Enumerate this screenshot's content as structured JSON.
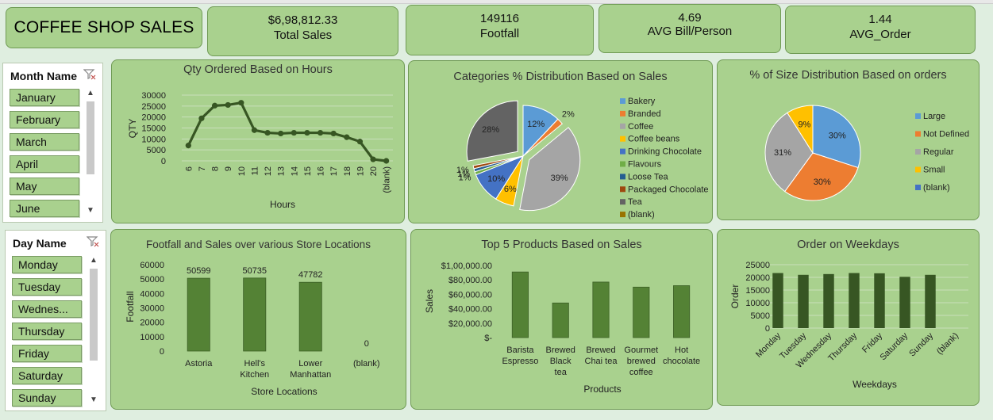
{
  "header": {
    "title": "COFFEE SHOP SALES",
    "kpis": [
      {
        "value": "$6,98,812.33",
        "label": "Total Sales"
      },
      {
        "value": "149116",
        "label": "Footfall"
      },
      {
        "value": "4.69",
        "label": "AVG Bill/Person"
      },
      {
        "value": "1.44",
        "label": "AVG_Order"
      }
    ]
  },
  "slicers": {
    "month": {
      "title": "Month Name",
      "items": [
        "January",
        "February",
        "March",
        "April",
        "May",
        "June"
      ]
    },
    "day": {
      "title": "Day Name",
      "items": [
        "Monday",
        "Tuesday",
        "Wednes...",
        "Thursday",
        "Friday",
        "Saturday",
        "Sunday"
      ]
    }
  },
  "colors": {
    "card_bg": "#a9d18e",
    "series_dark": "#375623",
    "bar_green": "#548235",
    "slicer_btn": "#a9d18e"
  },
  "chart_data": [
    {
      "type": "line",
      "title": "Qty Ordered Based on Hours",
      "xlabel": "Hours",
      "ylabel": "QTY",
      "categories": [
        "6",
        "7",
        "8",
        "9",
        "10",
        "11",
        "12",
        "13",
        "14",
        "15",
        "16",
        "17",
        "18",
        "19",
        "20",
        "(blank)"
      ],
      "values": [
        7000,
        19400,
        25200,
        25500,
        26500,
        14000,
        12800,
        12500,
        12800,
        12800,
        12800,
        12500,
        10800,
        8800,
        700,
        0
      ],
      "ylim": [
        0,
        30000
      ],
      "yticks": [
        "0",
        "5000",
        "10000",
        "15000",
        "20000",
        "25000",
        "30000"
      ],
      "grid": true
    },
    {
      "type": "pie",
      "title": "Categories % Distribution Based on Sales",
      "legend": "right",
      "slices": [
        {
          "name": "Bakery",
          "value": 12,
          "label": "12%",
          "color": "#5b9bd5"
        },
        {
          "name": "Branded",
          "value": 2,
          "label": "2%",
          "color": "#ed7d31"
        },
        {
          "name": "Coffee",
          "value": 39,
          "label": "39%",
          "color": "#a5a5a5"
        },
        {
          "name": "Coffee beans",
          "value": 6,
          "label": "6%",
          "color": "#ffc000"
        },
        {
          "name": "Drinking Chocolate",
          "value": 10,
          "label": "10%",
          "color": "#4472c4"
        },
        {
          "name": "Flavours",
          "value": 1,
          "label": "1%",
          "color": "#70ad47"
        },
        {
          "name": "Loose Tea",
          "value": 1,
          "label": "1%",
          "color": "#255e91"
        },
        {
          "name": "Packaged Chocolate",
          "value": 1,
          "label": "1%",
          "color": "#9e480e"
        },
        {
          "name": "Tea",
          "value": 28,
          "label": "28%",
          "color": "#636363"
        },
        {
          "name": "(blank)",
          "value": 0,
          "label": "",
          "color": "#997300"
        }
      ]
    },
    {
      "type": "pie",
      "title": "% of Size Distribution Based on orders",
      "legend": "right",
      "slices": [
        {
          "name": "Large",
          "value": 30,
          "label": "30%",
          "color": "#5b9bd5"
        },
        {
          "name": "Not Defined",
          "value": 30,
          "label": "30%",
          "color": "#ed7d31"
        },
        {
          "name": "Regular",
          "value": 31,
          "label": "31%",
          "color": "#a5a5a5"
        },
        {
          "name": "Small",
          "value": 9,
          "label": "9%",
          "color": "#ffc000"
        },
        {
          "name": "(blank)",
          "value": 0,
          "label": "",
          "color": "#4472c4"
        }
      ]
    },
    {
      "type": "bar",
      "title": "Footfall and Sales over various Store Locations",
      "xlabel": "Store Locations",
      "ylabel": "Footfall",
      "categories": [
        "Astoria",
        "Hell's Kitchen",
        "Lower Manhattan",
        "(blank)"
      ],
      "values": [
        50599,
        50735,
        47782,
        0
      ],
      "data_labels": [
        "50599",
        "50735",
        "47782",
        "0"
      ],
      "ylim": [
        0,
        60000
      ],
      "yticks": [
        "0",
        "10000",
        "20000",
        "30000",
        "40000",
        "50000",
        "60000"
      ]
    },
    {
      "type": "bar",
      "title": "Top 5 Products Based on Sales",
      "xlabel": "Products",
      "ylabel": "Sales",
      "categories": [
        "Barista Espresso",
        "Brewed Black tea",
        "Brewed Chai tea",
        "Gourmet brewed coffee",
        "Hot chocolate"
      ],
      "values": [
        91000,
        48000,
        77000,
        70000,
        72000
      ],
      "ylim": [
        0,
        100000
      ],
      "yticks": [
        "$-",
        "$20,000.00",
        "$40,000.00",
        "$60,000.00",
        "$80,000.00",
        "$1,00,000.00"
      ]
    },
    {
      "type": "bar",
      "title": "Order on Weekdays",
      "xlabel": "Weekdays",
      "ylabel": "Order",
      "categories": [
        "Monday",
        "Tuesday",
        "Wednesday",
        "Thursday",
        "Friday",
        "Saturday",
        "Sunday",
        "(blank)"
      ],
      "values": [
        21700,
        21000,
        21300,
        21700,
        21600,
        20200,
        21000,
        0
      ],
      "ylim": [
        0,
        25000
      ],
      "yticks": [
        "0",
        "5000",
        "10000",
        "15000",
        "20000",
        "25000"
      ]
    }
  ]
}
